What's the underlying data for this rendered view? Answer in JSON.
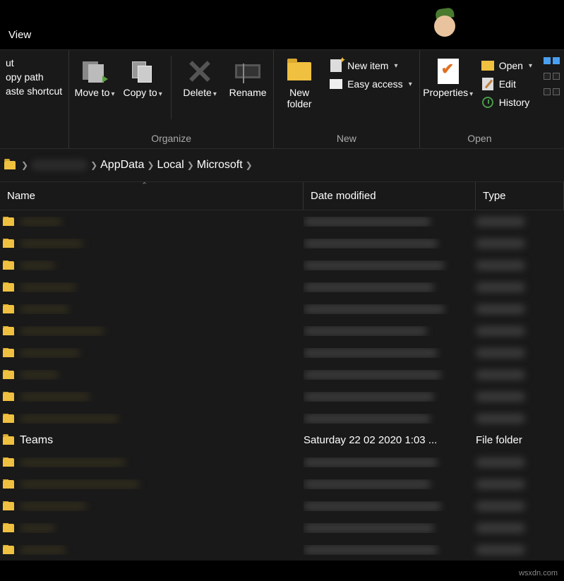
{
  "topbar": {
    "view_tab": "View"
  },
  "ribbon": {
    "clipboard": {
      "cut": "ut",
      "copy_path": "opy path",
      "paste_shortcut": "aste shortcut"
    },
    "organize": {
      "label": "Organize",
      "move_to": "Move to",
      "copy_to": "Copy to",
      "delete": "Delete",
      "rename": "Rename"
    },
    "new": {
      "label": "New",
      "new_folder": "New folder",
      "new_item": "New item",
      "easy_access": "Easy access"
    },
    "open": {
      "label": "Open",
      "properties": "Properties",
      "open": "Open",
      "edit": "Edit",
      "history": "History"
    }
  },
  "breadcrumb": {
    "items": [
      "AppData",
      "Local",
      "Microsoft"
    ]
  },
  "columns": {
    "name": "Name",
    "date": "Date modified",
    "type": "Type"
  },
  "visible_row": {
    "name": "Teams",
    "date": "Saturday 22 02 2020 1:03 ...",
    "type": "File folder"
  },
  "watermark": "wsxdn.com"
}
